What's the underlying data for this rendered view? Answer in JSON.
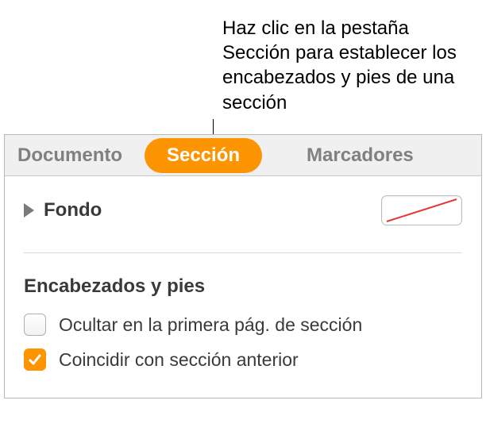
{
  "callout": {
    "text": "Haz clic en la pestaña Sección para establecer los encabezados y pies de una sección"
  },
  "tabs": {
    "document": "Documento",
    "section": "Sección",
    "bookmarks": "Marcadores"
  },
  "background": {
    "label": "Fondo"
  },
  "headersFooters": {
    "title": "Encabezados y pies",
    "hideFirst": {
      "label": "Ocultar en la primera pág. de sección",
      "checked": false
    },
    "matchPrev": {
      "label": "Coincidir con sección anterior",
      "checked": true
    }
  }
}
